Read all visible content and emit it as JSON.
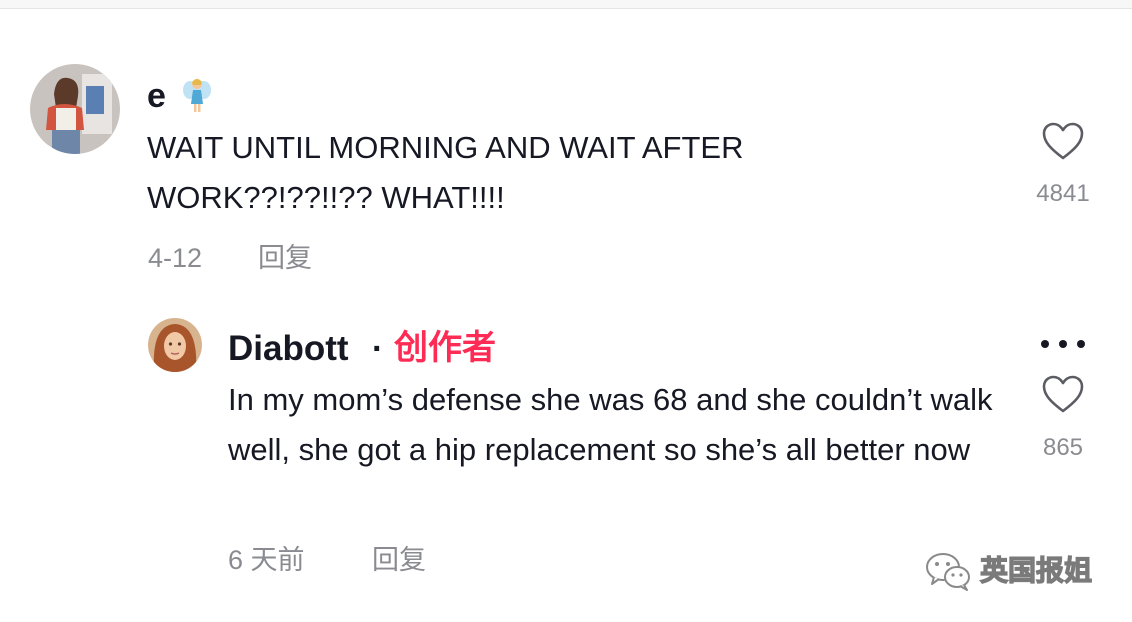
{
  "comments": {
    "main": {
      "username": "e",
      "text": "WAIT UNTIL MORNING AND WAIT AFTER WORK??!??!!?? WHAT!!!!",
      "date": "4-12",
      "reply_label": "回复",
      "likes": "4841",
      "avatar_icon": "user-avatar-photo",
      "badge_icon": "fairy-emoji-icon"
    },
    "reply": {
      "username": "Diabott",
      "separator": "·",
      "creator_tag": "创作者",
      "text": "In my mom’s defense she was 68 and she couldn’t walk well, she got a hip replacement so she’s all better now",
      "date": "6 天前",
      "reply_label": "回复",
      "likes": "865",
      "avatar_icon": "user-avatar-photo"
    }
  },
  "icons": {
    "like": "heart-outline-icon",
    "more": "more-dots-icon"
  },
  "watermark": {
    "text": "英国报姐",
    "icon": "wechat-icon"
  },
  "colors": {
    "text_primary": "#161823",
    "text_secondary": "#8a8b91",
    "creator_accent": "#fe2c55"
  }
}
